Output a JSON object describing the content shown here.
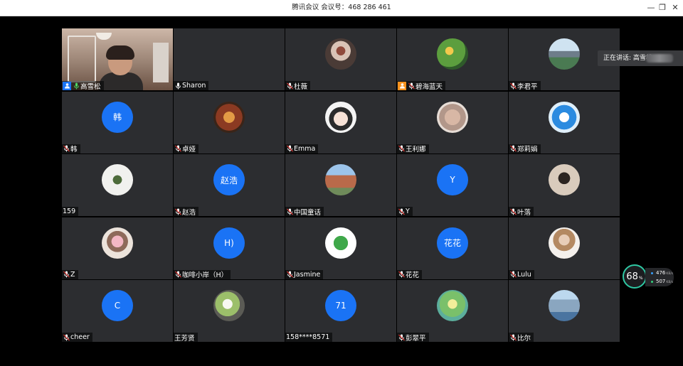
{
  "window": {
    "title": "腾讯会议 会议号：468 286 461",
    "minimize_glyph": "—",
    "restore_glyph": "❐",
    "close_glyph": "✕"
  },
  "notification": {
    "text": "正在讲话: 高雪松"
  },
  "network": {
    "score": "68",
    "score_unit": "%",
    "upload": "476",
    "upload_unit": "KB/s",
    "download": "507",
    "download_unit": "KB/s"
  },
  "colors": {
    "avatar_blue": "#1a73f5",
    "tile_bg": "#2c2d30",
    "host_badge": "#1a73f5",
    "cohost_badge": "#f7921e",
    "speaking_border": "#4cd964"
  },
  "participants": [
    {
      "name": "高雪松",
      "avatar": "camera-video",
      "mic": "on",
      "role": "host"
    },
    {
      "name": "Sharon",
      "avatar": "none",
      "mic": "on"
    },
    {
      "name": "杜薇",
      "avatar": "photo-figure-icon",
      "mic": "off"
    },
    {
      "name": "碧海蓝天",
      "avatar": "photo-kids-icon",
      "mic": "off",
      "role": "cohost"
    },
    {
      "name": "李君平",
      "avatar": "photo-landscape-icon",
      "mic": "off"
    },
    {
      "name": "韩",
      "avatar_text": "韩",
      "mic": "off"
    },
    {
      "name": "卓娅",
      "avatar": "photo-shop-icon",
      "mic": "off"
    },
    {
      "name": "Emma",
      "avatar": "photo-cartoon-girl-icon",
      "mic": "off"
    },
    {
      "name": "王利娜",
      "avatar": "photo-hands-icon",
      "mic": "off"
    },
    {
      "name": "郑莉娟",
      "avatar": "photo-doraemon-icon",
      "mic": "off"
    },
    {
      "name": "159",
      "avatar": "photo-orchid-icon",
      "mic": "none"
    },
    {
      "name": "赵浩",
      "avatar_text": "赵浩",
      "mic": "off"
    },
    {
      "name": "中国童话",
      "avatar": "photo-building-icon",
      "mic": "off"
    },
    {
      "name": "Y",
      "avatar_text": "Y",
      "mic": "off"
    },
    {
      "name": "叶落",
      "avatar": "photo-portrait-icon",
      "mic": "off"
    },
    {
      "name": "Z",
      "avatar": "photo-flowers-icon",
      "mic": "off"
    },
    {
      "name": "咖啡小岸（H）",
      "avatar_text": "H)",
      "mic": "off"
    },
    {
      "name": "Jasmine",
      "avatar": "photo-clover-icon",
      "mic": "off"
    },
    {
      "name": "花花",
      "avatar_text": "花花",
      "mic": "off"
    },
    {
      "name": "Lulu",
      "avatar": "photo-woman-icon",
      "mic": "off"
    },
    {
      "name": "cheer",
      "avatar_text": "C",
      "mic": "off"
    },
    {
      "name": "王芳贤",
      "avatar": "photo-blossom-icon",
      "mic": "none"
    },
    {
      "name": "158****8571",
      "avatar_text": "71",
      "mic": "none"
    },
    {
      "name": "彭翠平",
      "avatar": "photo-garden-icon",
      "mic": "off"
    },
    {
      "name": "比尔",
      "avatar": "photo-skyline-icon",
      "mic": "off"
    }
  ]
}
